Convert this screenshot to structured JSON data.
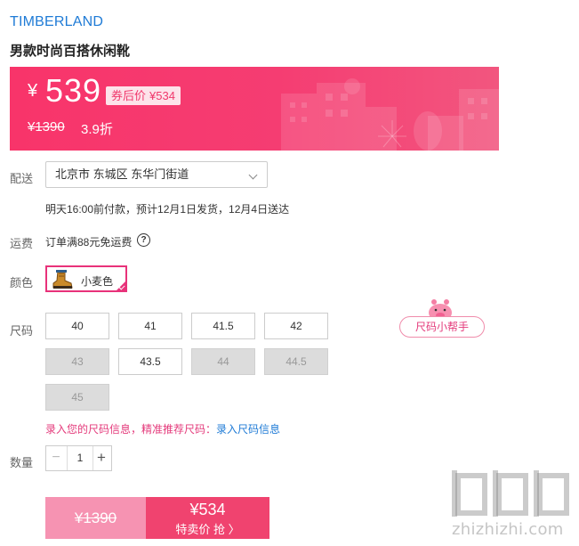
{
  "product": {
    "brand": "TIMBERLAND",
    "title": "男款时尚百搭休闲靴"
  },
  "price": {
    "currency": "¥",
    "amount": "539",
    "coupon_label": "券后价",
    "coupon_price": "¥534",
    "original": "¥1390",
    "discount": "3.9折"
  },
  "shipping": {
    "label": "配送",
    "address": "北京市 东城区 东华门街道",
    "delivery_note": "明天16:00前付款，预计12月1日发货，12月4日送达"
  },
  "fee": {
    "label": "运费",
    "text": "订单满88元免运费",
    "help": "?"
  },
  "color": {
    "label": "颜色",
    "selected": "小麦色"
  },
  "size": {
    "label": "尺码",
    "options": [
      {
        "value": "40",
        "available": true
      },
      {
        "value": "41",
        "available": true
      },
      {
        "value": "41.5",
        "available": true
      },
      {
        "value": "42",
        "available": true
      },
      {
        "value": "43",
        "available": false
      },
      {
        "value": "43.5",
        "available": true
      },
      {
        "value": "44",
        "available": false
      },
      {
        "value": "44.5",
        "available": false
      },
      {
        "value": "45",
        "available": false
      }
    ],
    "helper": "尺码小帮手",
    "info_text": "录入您的尺码信息，精准推荐尺码：",
    "info_link": "录入尺码信息"
  },
  "quantity": {
    "label": "数量",
    "value": "1",
    "minus": "−",
    "plus": "+"
  },
  "buy": {
    "original": "¥1390",
    "price": "¥534",
    "action": "特卖价 抢 〉"
  },
  "watermark": "zhizhizhi.com",
  "colors": {
    "accent": "#f0436f",
    "brand_blue": "#1f7bd6",
    "pink_text": "#e43a7b"
  }
}
